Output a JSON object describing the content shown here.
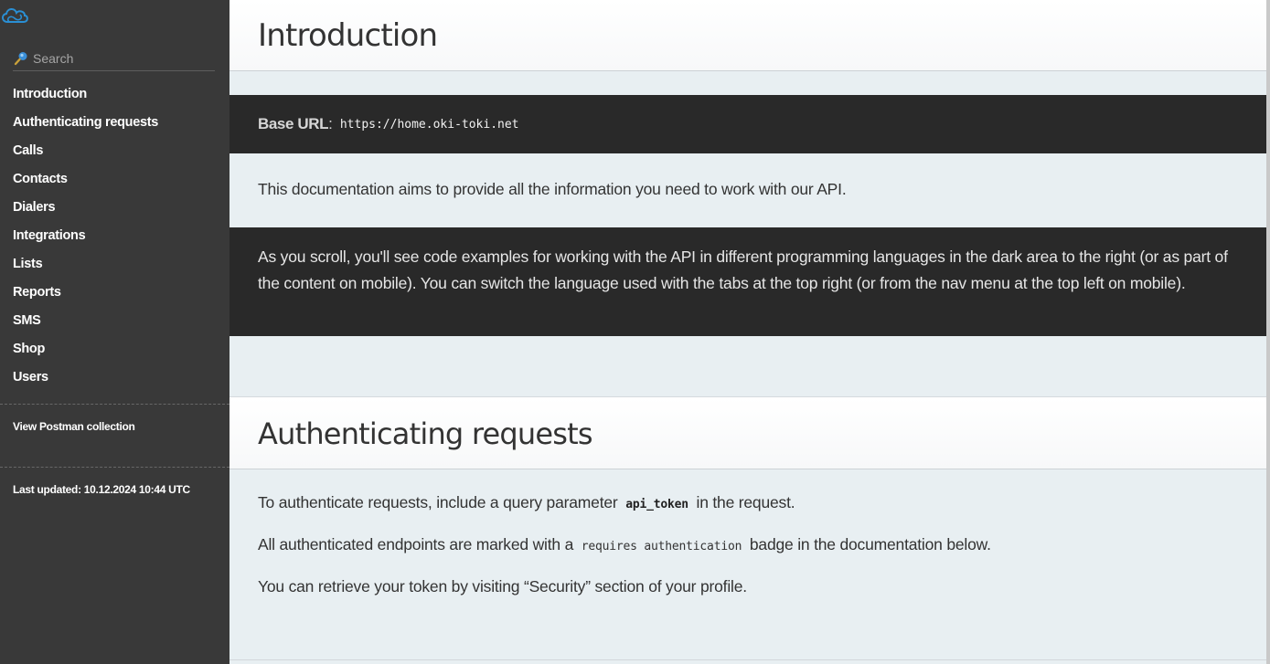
{
  "sidebar": {
    "logo": "cloud-logo",
    "search": {
      "placeholder": "Search",
      "value": ""
    },
    "items": [
      {
        "label": "Introduction"
      },
      {
        "label": "Authenticating requests"
      },
      {
        "label": "Calls"
      },
      {
        "label": "Contacts"
      },
      {
        "label": "Dialers"
      },
      {
        "label": "Integrations"
      },
      {
        "label": "Lists"
      },
      {
        "label": "Reports"
      },
      {
        "label": "SMS"
      },
      {
        "label": "Shop"
      },
      {
        "label": "Users"
      }
    ],
    "postman_link": "View Postman collection",
    "last_updated": "Last updated: 10.12.2024 10:44 UTC"
  },
  "main": {
    "intro": {
      "title": "Introduction",
      "base_url_label": "Base URL",
      "base_url_colon": ":",
      "base_url_value": "https://home.oki-toki.net",
      "description": "This documentation aims to provide all the information you need to work with our API.",
      "scroll_note": "As you scroll, you'll see code examples for working with the API in different programming languages in the dark area to the right (or as part of the content on mobile). You can switch the language used with the tabs at the top right (or from the nav menu at the top left on mobile)."
    },
    "auth": {
      "title": "Authenticating requests",
      "p1_before": "To authenticate requests, include a query parameter",
      "p1_code": "api_token",
      "p1_after": "in the request.",
      "p2_before": "All authenticated endpoints are marked with a",
      "p2_code": "requires authentication",
      "p2_after": "badge in the documentation below.",
      "p3": "You can retrieve your token by visiting “Security” section of your profile."
    }
  },
  "colors": {
    "sidebar_bg": "#393939",
    "dark_bar_bg": "#292929",
    "content_bg": "#e8eff2",
    "logo_blue": "#2a8fd4"
  }
}
